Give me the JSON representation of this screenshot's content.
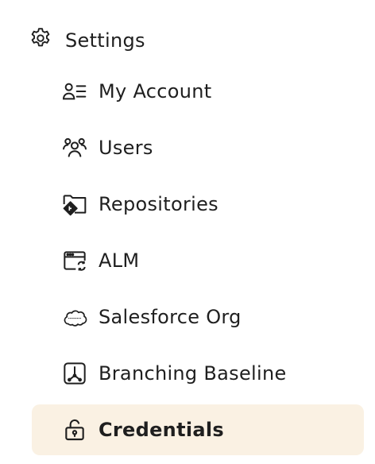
{
  "settings": {
    "title": "Settings",
    "icon": "gear-icon"
  },
  "nav": {
    "items": [
      {
        "label": "My Account",
        "icon": "account-list-icon"
      },
      {
        "label": "Users",
        "icon": "users-icon"
      },
      {
        "label": "Repositories",
        "icon": "repository-icon"
      },
      {
        "label": "ALM",
        "icon": "alm-window-icon"
      },
      {
        "label": "Salesforce Org",
        "icon": "salesforce-cloud-icon"
      },
      {
        "label": "Branching Baseline",
        "icon": "branching-icon"
      },
      {
        "label": "Credentials",
        "icon": "lock-icon",
        "active": true
      }
    ]
  },
  "colors": {
    "active_bg": "#faf1e3",
    "text": "#1f1f1f"
  }
}
